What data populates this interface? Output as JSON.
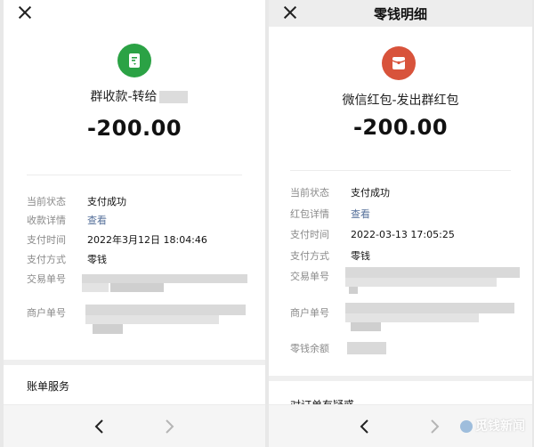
{
  "left": {
    "description": "群收款-转给",
    "amount": "-200.00",
    "fields": [
      {
        "label": "当前状态",
        "value": "支付成功"
      },
      {
        "label": "收款详情",
        "value": "查看"
      },
      {
        "label": "支付时间",
        "value": "2022年3月12日 18:04:46"
      },
      {
        "label": "支付方式",
        "value": "零钱"
      },
      {
        "label": "交易单号",
        "value": ""
      },
      {
        "label": "商户单号",
        "value": ""
      }
    ],
    "section_title": "账单服务"
  },
  "right": {
    "title": "零钱明细",
    "description": "微信红包-发出群红包",
    "amount": "-200.00",
    "fields": [
      {
        "label": "当前状态",
        "value": "支付成功"
      },
      {
        "label": "红包详情",
        "value": "查看"
      },
      {
        "label": "支付时间",
        "value": "2022-03-13 17:05:25"
      },
      {
        "label": "支付方式",
        "value": "零钱"
      },
      {
        "label": "交易单号",
        "value": ""
      },
      {
        "label": "商户单号",
        "value": ""
      },
      {
        "label": "零钱余额",
        "value": ""
      }
    ],
    "section_title": "对订单有疑惑"
  },
  "watermark": "觅钱新闻",
  "colors": {
    "wechat_green": "#2ba245",
    "redpacket_red": "#d8533b",
    "link_blue": "#56709a"
  },
  "icons": {
    "close": "close-icon",
    "back": "chevron-left-icon",
    "forward": "chevron-right-icon"
  }
}
